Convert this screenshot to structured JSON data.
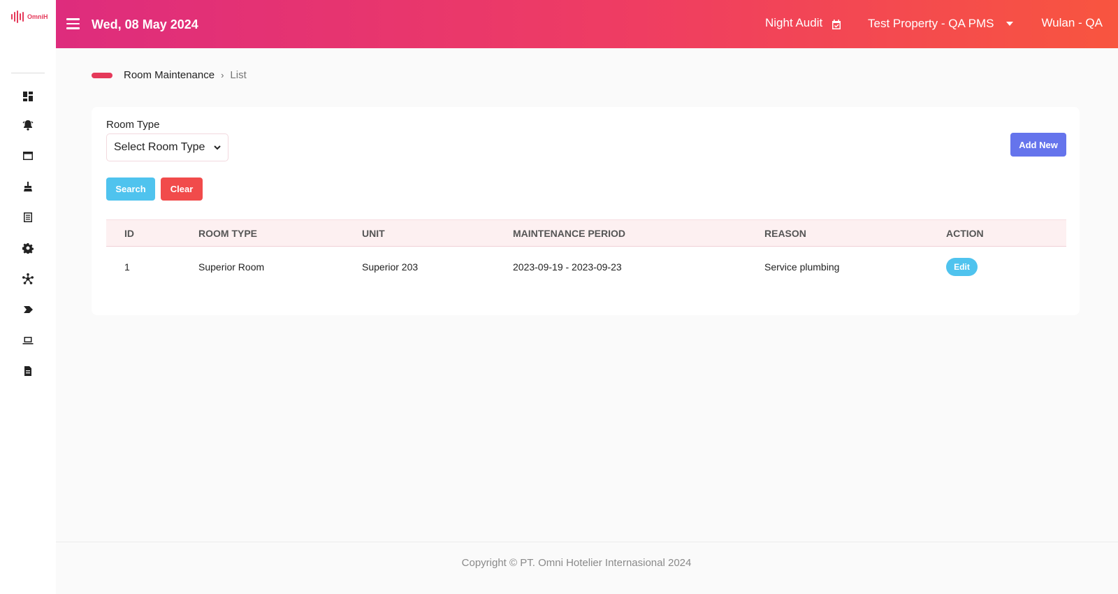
{
  "brand": {
    "logo_text": "OmniH",
    "accent": "#e5395a"
  },
  "header": {
    "date": "Wed, 08 May 2024",
    "night_audit": "Night Audit",
    "property": "Test Property - QA PMS",
    "user": "Wulan - QA",
    "gradient": [
      "#de2c7d",
      "#f8553f"
    ]
  },
  "sidebar": {
    "items": [
      {
        "icon": "dashboard-icon"
      },
      {
        "icon": "bell-icon"
      },
      {
        "icon": "window-icon"
      },
      {
        "icon": "housekeeping-icon"
      },
      {
        "icon": "list-icon"
      },
      {
        "icon": "gear-icon"
      },
      {
        "icon": "network-icon"
      },
      {
        "icon": "tag-icon"
      },
      {
        "icon": "laptop-icon"
      },
      {
        "icon": "report-icon"
      }
    ]
  },
  "breadcrumb": {
    "section": "Room Maintenance",
    "current": "List"
  },
  "filter": {
    "room_type_label": "Room Type",
    "room_type_value": "Select Room Type",
    "search_label": "Search",
    "clear_label": "Clear",
    "add_new_label": "Add New"
  },
  "table": {
    "columns": [
      "ID",
      "ROOM TYPE",
      "UNIT",
      "MAINTENANCE PERIOD",
      "REASON",
      "ACTION"
    ],
    "rows": [
      {
        "id": "1",
        "room_type": "Superior Room",
        "unit": "Superior 203",
        "period": "2023-09-19 - 2023-09-23",
        "reason": "Service plumbing",
        "action": "Edit"
      }
    ]
  },
  "footer": {
    "copyright": "Copyright © PT. Omni Hotelier Internasional 2024"
  },
  "colors": {
    "search": "#4fc3ee",
    "clear": "#f14b4b",
    "add_new": "#6574ec",
    "edit": "#4fc3ee"
  }
}
